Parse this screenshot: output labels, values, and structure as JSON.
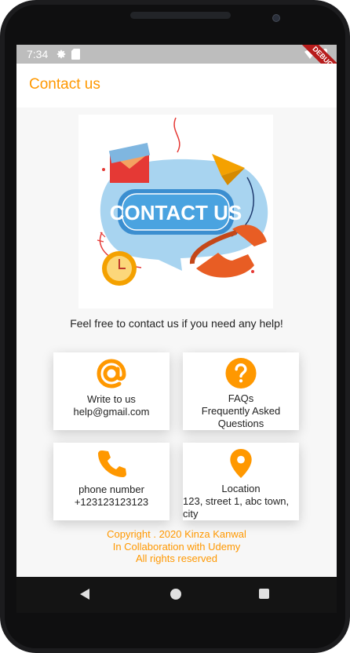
{
  "status_bar": {
    "time": "7:34"
  },
  "debug_banner": "DEBUG",
  "app_bar": {
    "title": "Contact us"
  },
  "hero": {
    "banner_text": "CONTACT US"
  },
  "tagline": "Feel free to contact us if you need any help!",
  "cards": [
    {
      "title": "Write to us",
      "detail": "help@gmail.com",
      "icon": "at-sign-icon"
    },
    {
      "title": "FAQs",
      "detail": "Frequently Asked Questions",
      "icon": "question-mark-icon"
    },
    {
      "title": "phone number",
      "detail": "+123123123123",
      "icon": "phone-icon"
    },
    {
      "title": "Location",
      "detail": "123, street 1, abc town, city",
      "icon": "location-pin-icon"
    }
  ],
  "footer": {
    "line1": "Copyright . 2020 Kinza Kanwal",
    "line2": "In Collaboration with Udemy",
    "line3": "All rights reserved"
  },
  "colors": {
    "accent": "#ff9800",
    "status_bar": "#bdbdbd",
    "debug": "#b71c1c"
  }
}
